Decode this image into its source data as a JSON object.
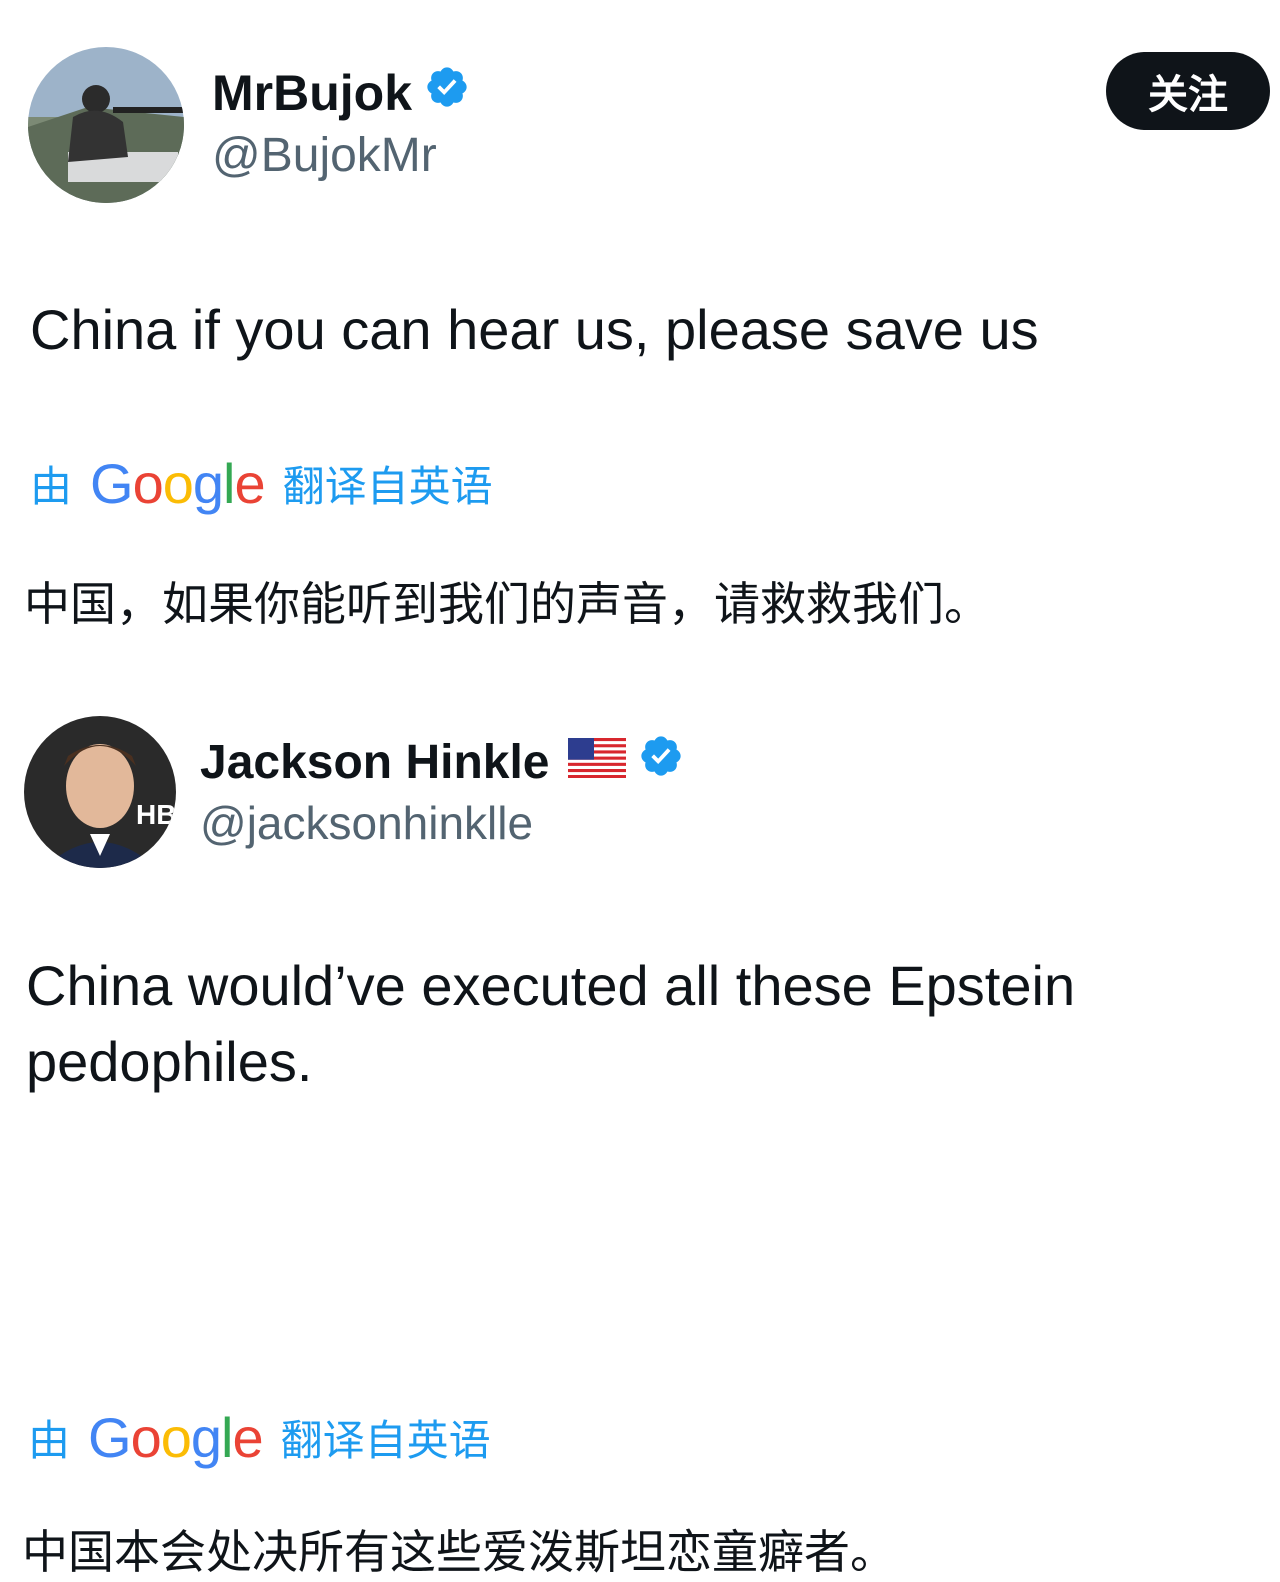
{
  "posts": [
    {
      "author": {
        "name": "MrBujok",
        "handle": "@BujokMr",
        "verified": true
      },
      "text": "China if you can hear us, please save us",
      "translation": {
        "by": "由",
        "brand": "Google",
        "suffix": "翻译自英语",
        "text": "中国，如果你能听到我们的声音，请救救我们。"
      }
    },
    {
      "author": {
        "name": "Jackson Hinkle",
        "handle": "@jacksonhinklle",
        "verified": true,
        "flag": "us-flag-icon"
      },
      "text": "China would’ve executed all these Epstein pedophiles.",
      "translation": {
        "by": "由",
        "brand": "Google",
        "suffix": "翻译自英语",
        "text": "中国本会处决所有这些爱泼斯坦恋童癖者。"
      }
    }
  ],
  "follow_label": "关注",
  "colors": {
    "accent": "#1d9bf0",
    "text": "#0f1419",
    "secondary": "#536471",
    "button": "#0f1419"
  }
}
